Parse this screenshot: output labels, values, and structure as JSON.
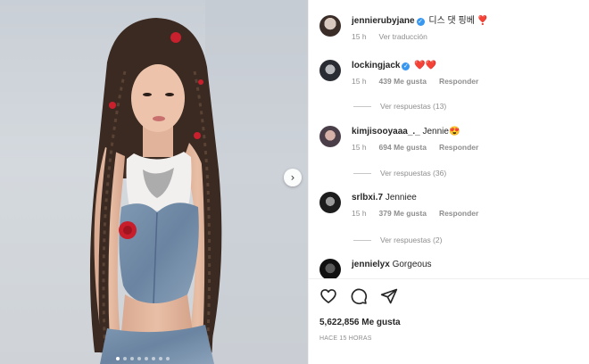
{
  "media": {
    "next_icon": "chevron-right-icon",
    "carousel_dots": 8,
    "carousel_active_index": 0
  },
  "caption": {
    "username": "jennierubyjane",
    "verified": true,
    "text": "디스 댓 핑베",
    "emoji": "❣️",
    "time": "15 h",
    "translate": "Ver traducción"
  },
  "comments": [
    {
      "username": "lockingjack",
      "verified": true,
      "text": "❤️❤️",
      "time": "15 h",
      "likes": "439 Me gusta",
      "reply": "Responder",
      "replies": "Ver respuestas (13)"
    },
    {
      "username": "kimjisooyaaa_._",
      "verified": false,
      "text": "Jennie😍",
      "time": "15 h",
      "likes": "694 Me gusta",
      "reply": "Responder",
      "replies": "Ver respuestas (36)"
    },
    {
      "username": "srlbxi.7",
      "verified": false,
      "text": "Jenniee",
      "time": "15 h",
      "likes": "379 Me gusta",
      "reply": "Responder",
      "replies": "Ver respuestas (2)"
    },
    {
      "username": "jennielyx",
      "verified": false,
      "text": "Gorgeous"
    }
  ],
  "actions": {
    "like_icon": "heart-outline-icon",
    "comment_icon": "comment-bubble-icon",
    "share_icon": "paper-plane-icon"
  },
  "likes_count": "5,622,856 Me gusta",
  "timestamp": "HACE 15 HORAS",
  "colors": {
    "verified": "#3897f0",
    "heart": "#ed4956",
    "muted_text": "#8e8e8e"
  }
}
